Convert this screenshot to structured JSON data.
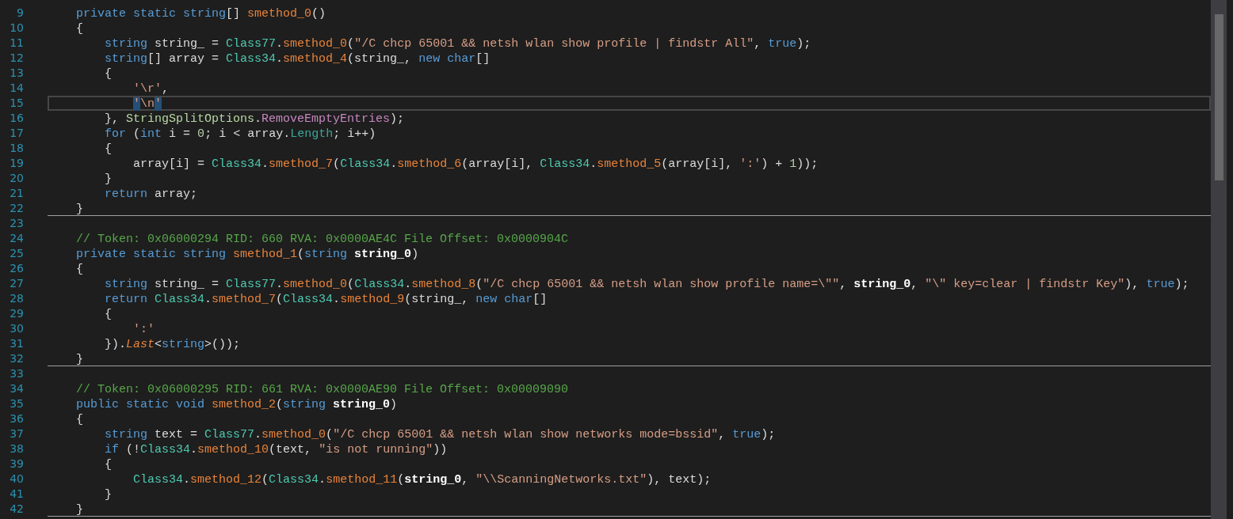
{
  "editor": {
    "lines": [
      {
        "number": "9",
        "current": false,
        "divider": false,
        "tokens": [
          {
            "kind": "keyword",
            "text": "    private static string"
          },
          {
            "kind": "plain",
            "text": "[] "
          },
          {
            "kind": "method",
            "text": "smethod_0"
          },
          {
            "kind": "plain",
            "text": "()"
          }
        ]
      },
      {
        "number": "10",
        "current": false,
        "divider": false,
        "tokens": [
          {
            "kind": "plain",
            "text": "    {"
          }
        ]
      },
      {
        "number": "11",
        "current": false,
        "divider": false,
        "tokens": [
          {
            "kind": "keyword",
            "text": "        string"
          },
          {
            "kind": "plain",
            "text": " string_ = "
          },
          {
            "kind": "type",
            "text": "Class77"
          },
          {
            "kind": "plain",
            "text": "."
          },
          {
            "kind": "method",
            "text": "smethod_0"
          },
          {
            "kind": "plain",
            "text": "("
          },
          {
            "kind": "string",
            "text": "\"/C chcp 65001 && netsh wlan show profile | findstr All\""
          },
          {
            "kind": "plain",
            "text": ", "
          },
          {
            "kind": "keyword",
            "text": "true"
          },
          {
            "kind": "plain",
            "text": ");"
          }
        ]
      },
      {
        "number": "12",
        "current": false,
        "divider": false,
        "tokens": [
          {
            "kind": "keyword",
            "text": "        string"
          },
          {
            "kind": "plain",
            "text": "[] array = "
          },
          {
            "kind": "type",
            "text": "Class34"
          },
          {
            "kind": "plain",
            "text": "."
          },
          {
            "kind": "method",
            "text": "smethod_4"
          },
          {
            "kind": "plain",
            "text": "(string_, "
          },
          {
            "kind": "keyword",
            "text": "new char"
          },
          {
            "kind": "plain",
            "text": "[]"
          }
        ]
      },
      {
        "number": "13",
        "current": false,
        "divider": false,
        "tokens": [
          {
            "kind": "plain",
            "text": "        {"
          }
        ]
      },
      {
        "number": "14",
        "current": false,
        "divider": false,
        "tokens": [
          {
            "kind": "string",
            "text": "            '\\r'"
          },
          {
            "kind": "plain",
            "text": ","
          }
        ]
      },
      {
        "number": "15",
        "current": true,
        "divider": false,
        "tokens": [
          {
            "kind": "match",
            "text": "            '"
          },
          {
            "kind": "string",
            "text": "\\n"
          },
          {
            "kind": "match",
            "text": "'"
          }
        ]
      },
      {
        "number": "16",
        "current": false,
        "divider": false,
        "tokens": [
          {
            "kind": "plain",
            "text": "        }, "
          },
          {
            "kind": "enum",
            "text": "StringSplitOptions"
          },
          {
            "kind": "plain",
            "text": "."
          },
          {
            "kind": "enum_value",
            "text": "RemoveEmptyEntries"
          },
          {
            "kind": "plain",
            "text": ");"
          }
        ]
      },
      {
        "number": "17",
        "current": false,
        "divider": false,
        "tokens": [
          {
            "kind": "keyword",
            "text": "        for"
          },
          {
            "kind": "plain",
            "text": " ("
          },
          {
            "kind": "keyword",
            "text": "int"
          },
          {
            "kind": "plain",
            "text": " i = "
          },
          {
            "kind": "number",
            "text": "0"
          },
          {
            "kind": "plain",
            "text": "; i < array."
          },
          {
            "kind": "property",
            "text": "Length"
          },
          {
            "kind": "plain",
            "text": "; i++)"
          }
        ]
      },
      {
        "number": "18",
        "current": false,
        "divider": false,
        "tokens": [
          {
            "kind": "plain",
            "text": "        {"
          }
        ]
      },
      {
        "number": "19",
        "current": false,
        "divider": false,
        "tokens": [
          {
            "kind": "plain",
            "text": "            array[i] = "
          },
          {
            "kind": "type",
            "text": "Class34"
          },
          {
            "kind": "plain",
            "text": "."
          },
          {
            "kind": "method",
            "text": "smethod_7"
          },
          {
            "kind": "plain",
            "text": "("
          },
          {
            "kind": "type",
            "text": "Class34"
          },
          {
            "kind": "plain",
            "text": "."
          },
          {
            "kind": "method",
            "text": "smethod_6"
          },
          {
            "kind": "plain",
            "text": "(array[i], "
          },
          {
            "kind": "type",
            "text": "Class34"
          },
          {
            "kind": "plain",
            "text": "."
          },
          {
            "kind": "method",
            "text": "smethod_5"
          },
          {
            "kind": "plain",
            "text": "(array[i], "
          },
          {
            "kind": "string",
            "text": "':'"
          },
          {
            "kind": "plain",
            "text": ") + "
          },
          {
            "kind": "number",
            "text": "1"
          },
          {
            "kind": "plain",
            "text": "));"
          }
        ]
      },
      {
        "number": "20",
        "current": false,
        "divider": false,
        "tokens": [
          {
            "kind": "plain",
            "text": "        }"
          }
        ]
      },
      {
        "number": "21",
        "current": false,
        "divider": false,
        "tokens": [
          {
            "kind": "keyword",
            "text": "        return"
          },
          {
            "kind": "plain",
            "text": " array;"
          }
        ]
      },
      {
        "number": "22",
        "current": false,
        "divider": true,
        "tokens": [
          {
            "kind": "plain",
            "text": "    }"
          }
        ]
      },
      {
        "number": "23",
        "current": false,
        "divider": false
      },
      {
        "number": "24",
        "current": false,
        "divider": false,
        "tokens": [
          {
            "kind": "comment",
            "text": "    // Token: 0x06000294 RID: 660 RVA: 0x0000AE4C File Offset: 0x0000904C"
          }
        ]
      },
      {
        "number": "25",
        "current": false,
        "divider": false,
        "tokens": [
          {
            "kind": "keyword",
            "text": "    private static string "
          },
          {
            "kind": "method",
            "text": "smethod_1"
          },
          {
            "kind": "plain",
            "text": "("
          },
          {
            "kind": "keyword",
            "text": "string "
          },
          {
            "kind": "parameter",
            "text": "string_0"
          },
          {
            "kind": "plain",
            "text": ")"
          }
        ]
      },
      {
        "number": "26",
        "current": false,
        "divider": false,
        "tokens": [
          {
            "kind": "plain",
            "text": "    {"
          }
        ]
      },
      {
        "number": "27",
        "current": false,
        "divider": false,
        "tokens": [
          {
            "kind": "keyword",
            "text": "        string"
          },
          {
            "kind": "plain",
            "text": " string_ = "
          },
          {
            "kind": "type",
            "text": "Class77"
          },
          {
            "kind": "plain",
            "text": "."
          },
          {
            "kind": "method",
            "text": "smethod_0"
          },
          {
            "kind": "plain",
            "text": "("
          },
          {
            "kind": "type",
            "text": "Class34"
          },
          {
            "kind": "plain",
            "text": "."
          },
          {
            "kind": "method",
            "text": "smethod_8"
          },
          {
            "kind": "plain",
            "text": "("
          },
          {
            "kind": "string",
            "text": "\"/C chcp 65001 && netsh wlan show profile name=\\\"\""
          },
          {
            "kind": "plain",
            "text": ", "
          },
          {
            "kind": "parameter",
            "text": "string_0"
          },
          {
            "kind": "plain",
            "text": ", "
          },
          {
            "kind": "string",
            "text": "\"\\\" key=clear | findstr Key\""
          },
          {
            "kind": "plain",
            "text": "), "
          },
          {
            "kind": "keyword",
            "text": "true"
          },
          {
            "kind": "plain",
            "text": ");"
          }
        ]
      },
      {
        "number": "28",
        "current": false,
        "divider": false,
        "tokens": [
          {
            "kind": "keyword",
            "text": "        return "
          },
          {
            "kind": "type",
            "text": "Class34"
          },
          {
            "kind": "plain",
            "text": "."
          },
          {
            "kind": "method",
            "text": "smethod_7"
          },
          {
            "kind": "plain",
            "text": "("
          },
          {
            "kind": "type",
            "text": "Class34"
          },
          {
            "kind": "plain",
            "text": "."
          },
          {
            "kind": "method",
            "text": "smethod_9"
          },
          {
            "kind": "plain",
            "text": "(string_, "
          },
          {
            "kind": "keyword",
            "text": "new char"
          },
          {
            "kind": "plain",
            "text": "[]"
          }
        ]
      },
      {
        "number": "29",
        "current": false,
        "divider": false,
        "tokens": [
          {
            "kind": "plain",
            "text": "        {"
          }
        ]
      },
      {
        "number": "30",
        "current": false,
        "divider": false,
        "tokens": [
          {
            "kind": "string",
            "text": "            ':'"
          }
        ]
      },
      {
        "number": "31",
        "current": false,
        "divider": false,
        "tokens": [
          {
            "kind": "plain",
            "text": "        })."
          },
          {
            "kind": "extension",
            "text": "Last"
          },
          {
            "kind": "plain",
            "text": "<"
          },
          {
            "kind": "keyword",
            "text": "string"
          },
          {
            "kind": "plain",
            "text": ">());"
          }
        ]
      },
      {
        "number": "32",
        "current": false,
        "divider": true,
        "tokens": [
          {
            "kind": "plain",
            "text": "    }"
          }
        ]
      },
      {
        "number": "33",
        "current": false,
        "divider": false
      },
      {
        "number": "34",
        "current": false,
        "divider": false,
        "tokens": [
          {
            "kind": "comment",
            "text": "    // Token: 0x06000295 RID: 661 RVA: 0x0000AE90 File Offset: 0x00009090"
          }
        ]
      },
      {
        "number": "35",
        "current": false,
        "divider": false,
        "tokens": [
          {
            "kind": "keyword",
            "text": "    public static void "
          },
          {
            "kind": "method",
            "text": "smethod_2"
          },
          {
            "kind": "plain",
            "text": "("
          },
          {
            "kind": "keyword",
            "text": "string "
          },
          {
            "kind": "parameter",
            "text": "string_0"
          },
          {
            "kind": "plain",
            "text": ")"
          }
        ]
      },
      {
        "number": "36",
        "current": false,
        "divider": false,
        "tokens": [
          {
            "kind": "plain",
            "text": "    {"
          }
        ]
      },
      {
        "number": "37",
        "current": false,
        "divider": false,
        "tokens": [
          {
            "kind": "keyword",
            "text": "        string"
          },
          {
            "kind": "plain",
            "text": " text = "
          },
          {
            "kind": "type",
            "text": "Class77"
          },
          {
            "kind": "plain",
            "text": "."
          },
          {
            "kind": "method",
            "text": "smethod_0"
          },
          {
            "kind": "plain",
            "text": "("
          },
          {
            "kind": "string",
            "text": "\"/C chcp 65001 && netsh wlan show networks mode=bssid\""
          },
          {
            "kind": "plain",
            "text": ", "
          },
          {
            "kind": "keyword",
            "text": "true"
          },
          {
            "kind": "plain",
            "text": ");"
          }
        ]
      },
      {
        "number": "38",
        "current": false,
        "divider": false,
        "tokens": [
          {
            "kind": "keyword",
            "text": "        if"
          },
          {
            "kind": "plain",
            "text": " (!"
          },
          {
            "kind": "type",
            "text": "Class34"
          },
          {
            "kind": "plain",
            "text": "."
          },
          {
            "kind": "method",
            "text": "smethod_10"
          },
          {
            "kind": "plain",
            "text": "(text, "
          },
          {
            "kind": "string",
            "text": "\"is not running\""
          },
          {
            "kind": "plain",
            "text": "))"
          }
        ]
      },
      {
        "number": "39",
        "current": false,
        "divider": false,
        "tokens": [
          {
            "kind": "plain",
            "text": "        {"
          }
        ]
      },
      {
        "number": "40",
        "current": false,
        "divider": false,
        "tokens": [
          {
            "kind": "type",
            "text": "            Class34"
          },
          {
            "kind": "plain",
            "text": "."
          },
          {
            "kind": "method",
            "text": "smethod_12"
          },
          {
            "kind": "plain",
            "text": "("
          },
          {
            "kind": "type",
            "text": "Class34"
          },
          {
            "kind": "plain",
            "text": "."
          },
          {
            "kind": "method",
            "text": "smethod_11"
          },
          {
            "kind": "plain",
            "text": "("
          },
          {
            "kind": "parameter",
            "text": "string_0"
          },
          {
            "kind": "plain",
            "text": ", "
          },
          {
            "kind": "string",
            "text": "\"\\\\ScanningNetworks.txt\""
          },
          {
            "kind": "plain",
            "text": "), text);"
          }
        ]
      },
      {
        "number": "41",
        "current": false,
        "divider": false,
        "tokens": [
          {
            "kind": "plain",
            "text": "        }"
          }
        ]
      },
      {
        "number": "42",
        "current": false,
        "divider": true,
        "tokens": [
          {
            "kind": "plain",
            "text": "    }"
          }
        ]
      }
    ]
  }
}
